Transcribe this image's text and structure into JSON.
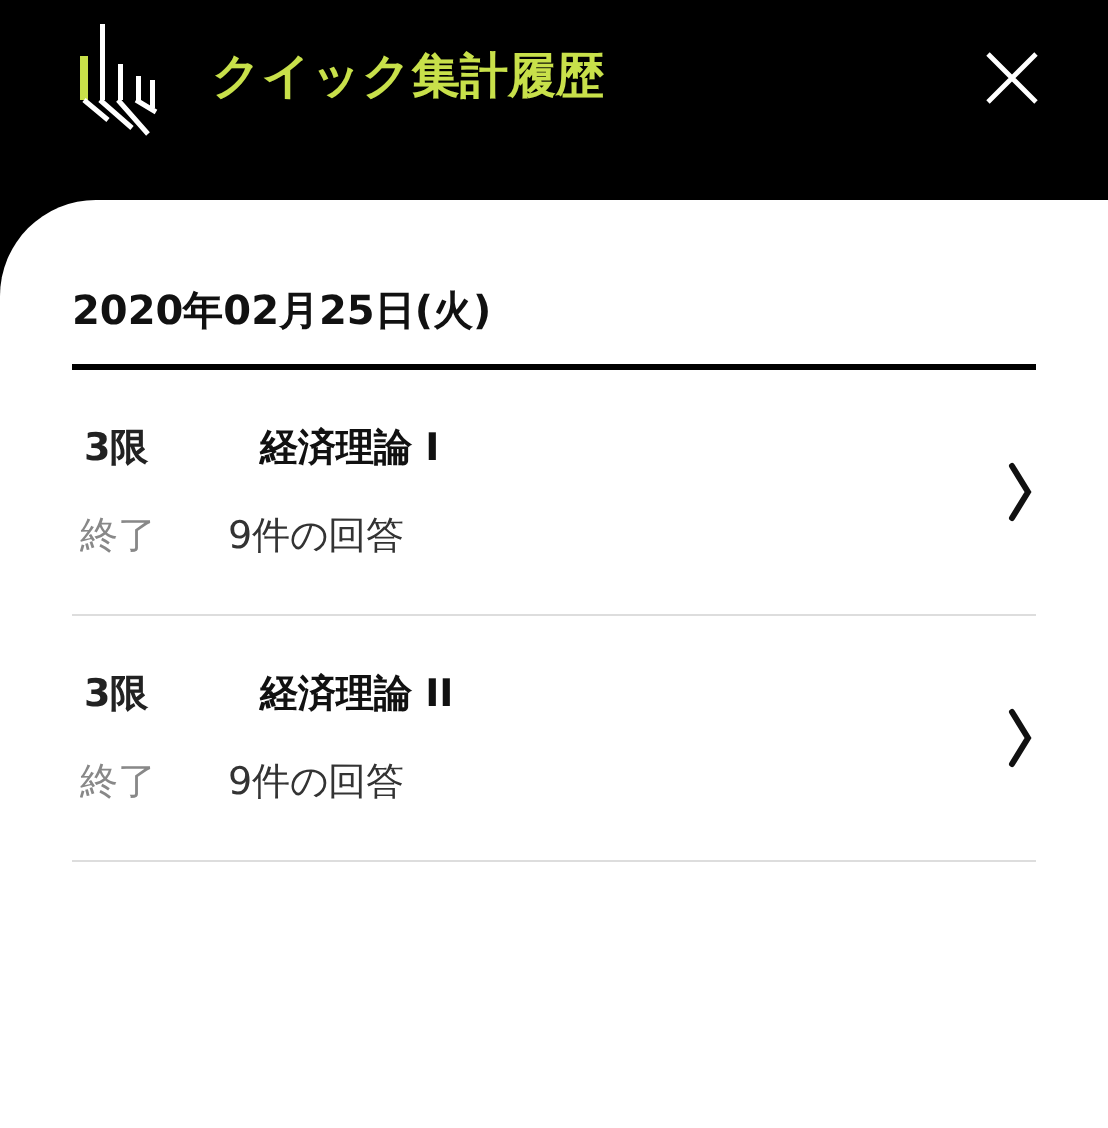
{
  "header": {
    "title": "クイック集計履歴"
  },
  "date_heading": "2020年02月25日(火)",
  "sessions": [
    {
      "period": "3限",
      "course": "経済理論 I",
      "status": "終了",
      "responses": "9件の回答"
    },
    {
      "period": "3限",
      "course": "経済理論 II",
      "status": "終了",
      "responses": "9件の回答"
    }
  ]
}
